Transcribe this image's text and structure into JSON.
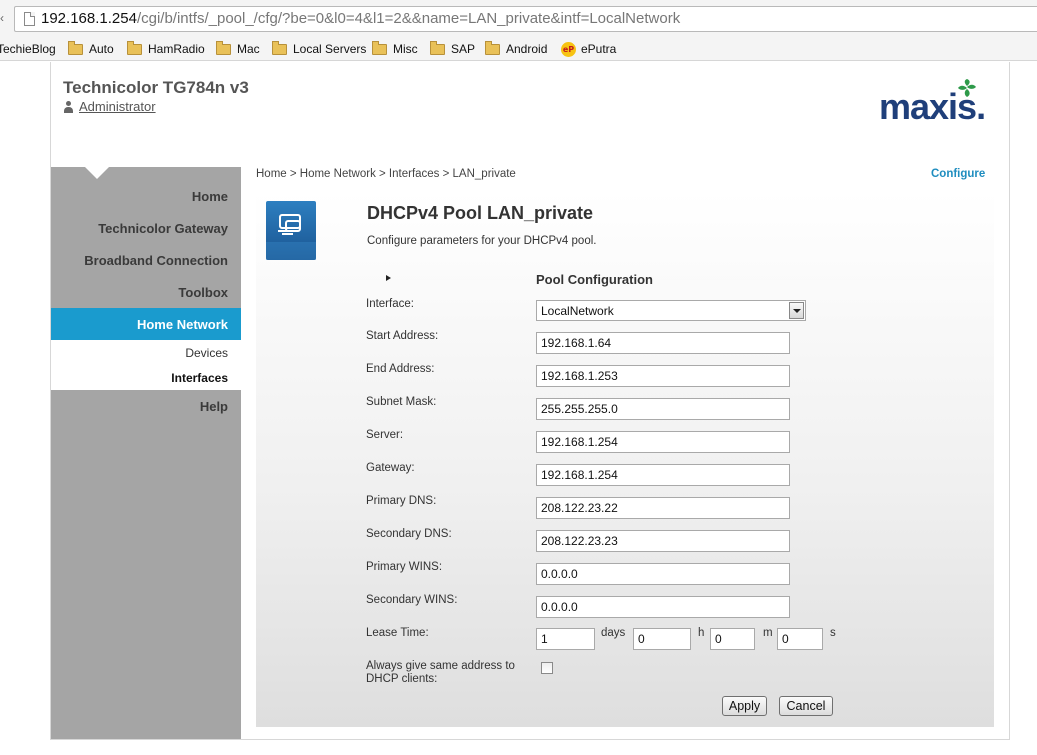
{
  "browser": {
    "left_edge_char": "‹",
    "url_host": "192.168.1.254",
    "url_path": "/cgi/b/intfs/_pool_/cfg/?be=0&l0=4&l1=2&&name=LAN_private&intf=LocalNetwork",
    "bookmarks": [
      {
        "label": "TechieBlog",
        "icon": "none"
      },
      {
        "label": "Auto",
        "icon": "folder-icon"
      },
      {
        "label": "HamRadio",
        "icon": "folder-icon"
      },
      {
        "label": "Mac",
        "icon": "folder-icon"
      },
      {
        "label": "Local Servers",
        "icon": "folder-icon"
      },
      {
        "label": "Misc",
        "icon": "folder-icon"
      },
      {
        "label": "SAP",
        "icon": "folder-icon"
      },
      {
        "label": "Android",
        "icon": "folder-icon"
      },
      {
        "label": "ePutra",
        "icon": "eputra-icon"
      }
    ]
  },
  "header": {
    "device_title": "Technicolor TG784n v3",
    "user": "Administrator",
    "logo_text": "maxis."
  },
  "sidebar": {
    "items": [
      "Home",
      "Technicolor Gateway",
      "Broadband Connection",
      "Toolbox"
    ],
    "active": "Home Network",
    "subitems": [
      "Devices",
      "Interfaces"
    ],
    "help": "Help"
  },
  "breadcrumb": "Home > Home Network > Interfaces > LAN_private",
  "configure_link": "Configure",
  "panel": {
    "title": "DHCPv4 Pool LAN_private",
    "description": "Configure parameters for your DHCPv4 pool.",
    "section": "Pool Configuration"
  },
  "form": {
    "interface_label": "Interface:",
    "interface_value": "LocalNetwork",
    "start_label": "Start Address:",
    "start_value": "192.168.1.64",
    "end_label": "End Address:",
    "end_value": "192.168.1.253",
    "subnet_label": "Subnet Mask:",
    "subnet_value": "255.255.255.0",
    "server_label": "Server:",
    "server_value": "192.168.1.254",
    "gateway_label": "Gateway:",
    "gateway_value": "192.168.1.254",
    "pdns_label": "Primary DNS:",
    "pdns_value": "208.122.23.22",
    "sdns_label": "Secondary DNS:",
    "sdns_value": "208.122.23.23",
    "pwins_label": "Primary WINS:",
    "pwins_value": "0.0.0.0",
    "swins_label": "Secondary WINS:",
    "swins_value": "0.0.0.0",
    "lease_label": "Lease Time:",
    "lease_days": "1",
    "days_unit": "days",
    "lease_hours": "0",
    "hours_unit": "h",
    "lease_minutes": "0",
    "minutes_unit": "m",
    "lease_seconds": "0",
    "seconds_unit": "s",
    "same_addr_label_1": "Always give same address to",
    "same_addr_label_2": "DHCP clients:",
    "same_addr_checked": false
  },
  "buttons": {
    "apply": "Apply",
    "cancel": "Cancel"
  },
  "colors": {
    "accent": "#1a9bce",
    "sidebar": "#a5a5a5",
    "logo": "#1f3f7a",
    "logo_leaf": "#2e9a4a"
  }
}
